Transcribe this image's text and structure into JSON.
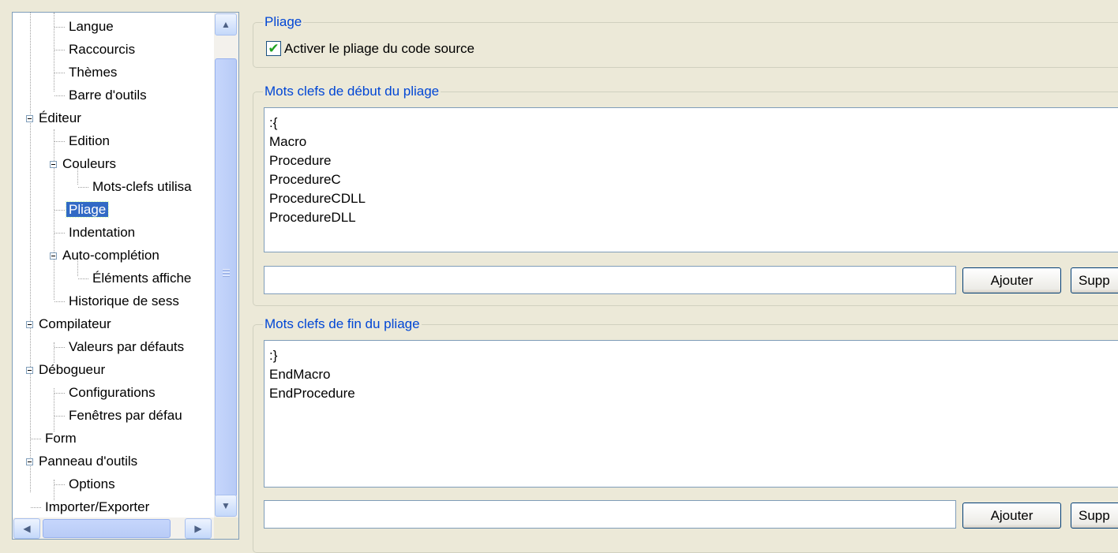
{
  "tree": {
    "items": [
      {
        "label": "Langue"
      },
      {
        "label": "Raccourcis"
      },
      {
        "label": "Thèmes"
      },
      {
        "label": "Barre d'outils"
      },
      {
        "label": "Éditeur"
      },
      {
        "label": "Edition"
      },
      {
        "label": "Couleurs"
      },
      {
        "label": "Mots-clefs utilisa"
      },
      {
        "label": "Pliage"
      },
      {
        "label": "Indentation"
      },
      {
        "label": "Auto-complétion"
      },
      {
        "label": "Éléments affiche"
      },
      {
        "label": "Historique de sess"
      },
      {
        "label": "Compilateur"
      },
      {
        "label": "Valeurs par défauts"
      },
      {
        "label": "Débogueur"
      },
      {
        "label": "Configurations"
      },
      {
        "label": "Fenêtres par défau"
      },
      {
        "label": "Form"
      },
      {
        "label": "Panneau d'outils"
      },
      {
        "label": "Options"
      },
      {
        "label": "Importer/Exporter"
      }
    ],
    "selected": "Pliage"
  },
  "folding": {
    "group_title": "Pliage",
    "enable_label": "Activer le pliage du code source",
    "enable_checked": true
  },
  "start_keywords": {
    "group_title": "Mots clefs de début du pliage",
    "items": [
      ":{",
      "Macro",
      "Procedure",
      "ProcedureC",
      "ProcedureCDLL",
      "ProcedureDLL"
    ],
    "input_value": "",
    "add_label": "Ajouter",
    "remove_label": "Supp"
  },
  "end_keywords": {
    "group_title": "Mots clefs de fin du pliage",
    "items": [
      ":}",
      "EndMacro",
      "EndProcedure"
    ],
    "input_value": "",
    "add_label": "Ajouter",
    "remove_label": "Supp"
  },
  "icons": {
    "scroll_up": "▲",
    "scroll_down": "▼",
    "scroll_left": "◀",
    "scroll_right": "▶",
    "check": "✔"
  },
  "colors": {
    "group_title": "#0046d5",
    "selection": "#316ac5",
    "window_bg": "#ece9d8"
  }
}
